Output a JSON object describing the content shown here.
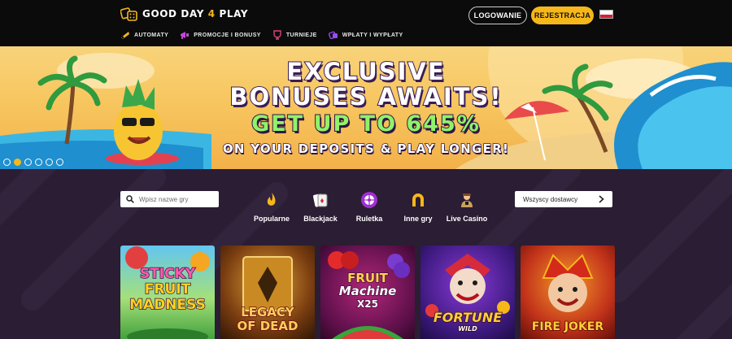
{
  "brand": {
    "name_part1": "GOOD DAY ",
    "name_part2": "4",
    "name_part3": " PLAY"
  },
  "header": {
    "login_label": "LOGOWANIE",
    "register_label": "REJESTRACJA"
  },
  "nav": [
    {
      "label": "AUTOMATY",
      "icon": "cherry-icon"
    },
    {
      "label": "PROMOCJE I BONUSY",
      "icon": "megaphone-icon"
    },
    {
      "label": "TURNIEJE",
      "icon": "trophy-icon"
    },
    {
      "label": "WPŁATY I WYPŁATY",
      "icon": "dice-icon"
    }
  ],
  "hero": {
    "line1": "EXCLUSIVE",
    "line2": "BONUSES AWAITS!",
    "line3": "GET UP TO 645%",
    "line4": "ON YOUR DEPOSITS & PLAY LONGER!",
    "slides": 6,
    "active_slide": 2
  },
  "lobby": {
    "search_placeholder": "Wpisz nazwe gry",
    "provider_label": "Wszyscy dostawcy",
    "categories": [
      {
        "label": "Popularne",
        "icon": "flame-icon"
      },
      {
        "label": "Blackjack",
        "icon": "cards-icon"
      },
      {
        "label": "Ruletka",
        "icon": "roulette-icon"
      },
      {
        "label": "Inne gry",
        "icon": "horseshoe-icon"
      },
      {
        "label": "Live Casino",
        "icon": "dealer-icon"
      }
    ],
    "games": [
      {
        "title": "Sticky Fruit Madness",
        "title_lines": [
          "STICKY",
          "FRUIT",
          "MADNESS"
        ]
      },
      {
        "title": "Legacy of Dead",
        "title_lines": [
          "LEGACY",
          "OF DEAD"
        ]
      },
      {
        "title": "Fruit Machine x25",
        "title_lines": [
          "FRUIT",
          "Machine",
          "X25"
        ]
      },
      {
        "title": "Fortune Wild",
        "title_lines": [
          "FORTUNE",
          "WILD"
        ]
      },
      {
        "title": "Fire Joker",
        "title_lines": [
          "FIRE JOKER"
        ]
      }
    ]
  },
  "colors": {
    "accent": "#f6b71a",
    "background": "#0b0b0c",
    "lobby": "#2b1d33",
    "promo_green": "#8ff36a"
  }
}
